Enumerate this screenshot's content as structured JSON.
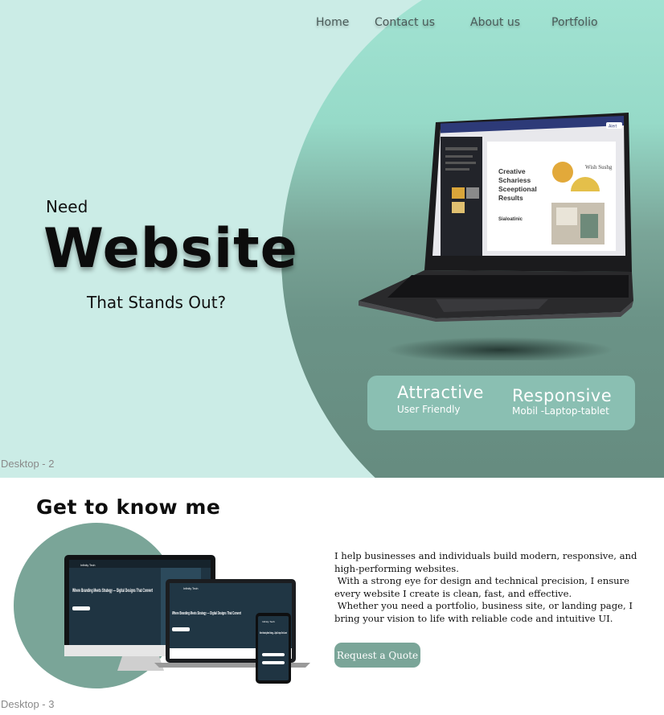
{
  "colors": {
    "hero_bg": "#cbece6",
    "accent": "#7aa598",
    "feature_box": "#8abfb2",
    "heading": "#0c0c0c"
  },
  "nav": {
    "items": [
      {
        "label": "Home"
      },
      {
        "label": "Contact us"
      },
      {
        "label": "About us"
      },
      {
        "label": "Portfolio"
      }
    ]
  },
  "hero": {
    "need": "Need",
    "headline": "Website",
    "subline": "That Stands Out?",
    "frame_label": "Desktop - 2",
    "features": [
      {
        "title": "Attractive",
        "subtitle": "User Friendly"
      },
      {
        "title": "Responsive",
        "subtitle": "Mobil -Laptop-tablet"
      }
    ],
    "laptop_screen": {
      "heading_lines": [
        "Creative",
        "Schariess",
        "Sceeptional",
        "Results"
      ],
      "side_text": "Sialoatinic",
      "corner_text": "Wish Sushg",
      "button": "Alert"
    }
  },
  "about": {
    "heading": "Get to know me",
    "paragraphs": [
      "I help businesses and individuals build modern, responsive, and high-performing websites.",
      " With a strong eye for design and technical precision, I ensure every website I create is clean, fast, and effective.",
      " Whether you need a portfolio, business site, or landing page, I bring your vision to life with reliable code and intuitive UI."
    ],
    "cta": "Request a Quote",
    "frame_label": "Desktop - 3",
    "mockup": {
      "brand": "Infinity Tech",
      "headline": "Where Branding Meets Strategy — Digital Designs That Convert",
      "mobile_headline": "Where Branding Meets Strategy — Digital Designs That Convert"
    }
  }
}
